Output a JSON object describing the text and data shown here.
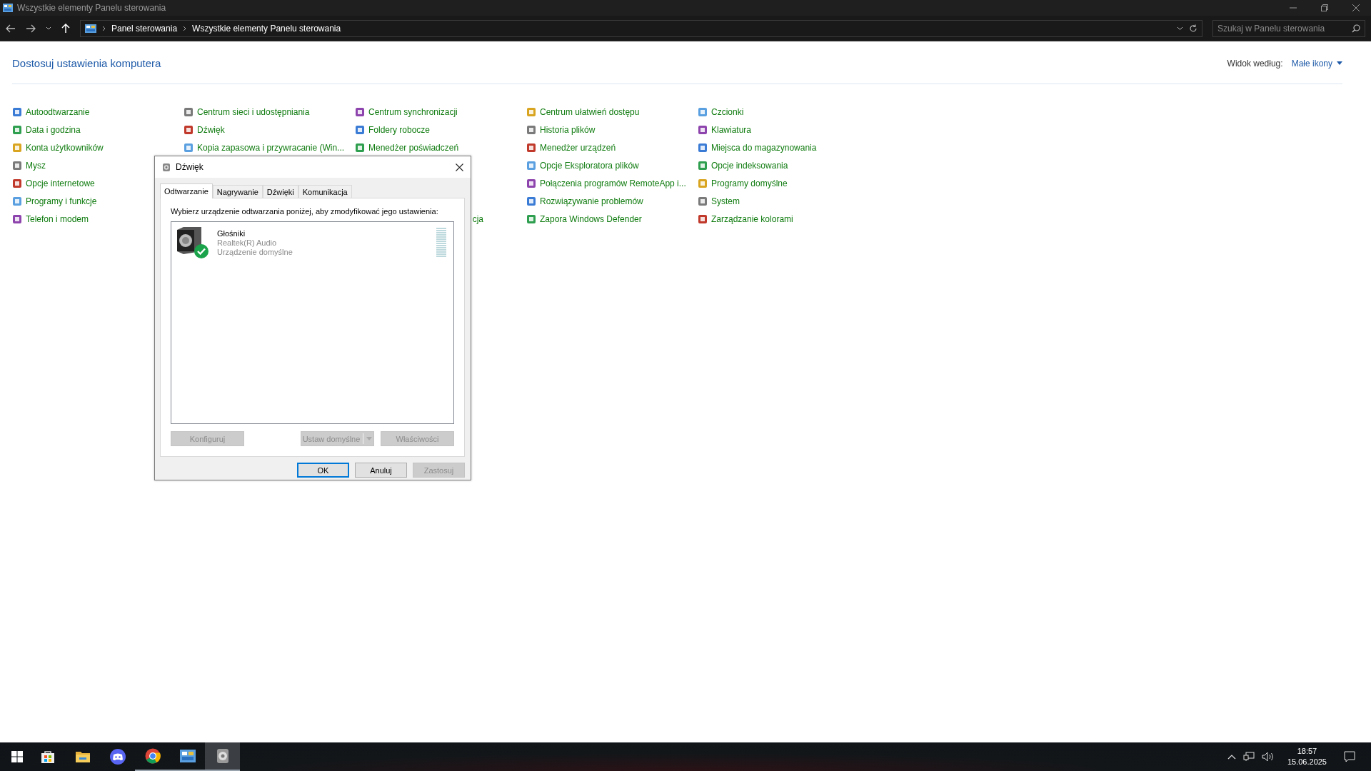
{
  "window": {
    "title": "Wszystkie elementy Panelu sterowania"
  },
  "address_bar": {
    "breadcrumbs": [
      "Panel sterowania",
      "Wszystkie elementy Panelu sterowania"
    ]
  },
  "search": {
    "placeholder": "Szukaj w Panelu sterowania"
  },
  "heading": "Dostosuj ustawienia komputera",
  "view_by": {
    "label": "Widok według:",
    "value": "Małe ikony"
  },
  "columns": [
    [
      {
        "label": "Autoodtwarzanie"
      },
      {
        "label": "Data i godzina"
      },
      {
        "label": "Konta użytkowników"
      },
      {
        "label": "Mysz"
      },
      {
        "label": "Opcje internetowe"
      },
      {
        "label": "Programy i funkcje"
      },
      {
        "label": "Telefon i modem"
      }
    ],
    [
      {
        "label": "Centrum sieci i udostępniania"
      },
      {
        "label": "Dźwięk"
      },
      {
        "label": "Kopia zapasowa i przywracanie (Win..."
      }
    ],
    [
      {
        "label": "Centrum synchronizacji"
      },
      {
        "label": "Foldery robocze"
      },
      {
        "label": "Menedżer poświadczeń"
      },
      {
        "label": "cja",
        "kind": "fragment"
      }
    ],
    [
      {
        "label": "Centrum ułatwień dostępu"
      },
      {
        "label": "Historia plików"
      },
      {
        "label": "Menedżer urządzeń"
      },
      {
        "label": "Opcje Eksploratora plików"
      },
      {
        "label": "Połączenia programów RemoteApp i..."
      },
      {
        "label": "Rozwiązywanie problemów"
      },
      {
        "label": "Zapora Windows Defender"
      }
    ],
    [
      {
        "label": "Czcionki"
      },
      {
        "label": "Klawiatura"
      },
      {
        "label": "Miejsca do magazynowania"
      },
      {
        "label": "Opcje indeksowania"
      },
      {
        "label": "Programy domyślne"
      },
      {
        "label": "System"
      },
      {
        "label": "Zarządzanie kolorami"
      }
    ]
  ],
  "dialog": {
    "title": "Dźwięk",
    "tabs": [
      {
        "label": "Odtwarzanie",
        "selected": true
      },
      {
        "label": "Nagrywanie",
        "selected": false
      },
      {
        "label": "Dźwięki",
        "selected": false
      },
      {
        "label": "Komunikacja",
        "selected": false
      }
    ],
    "instruction": "Wybierz urządzenie odtwarzania poniżej, aby zmodyfikować jego ustawienia:",
    "devices": [
      {
        "name": "Głośniki",
        "driver": "Realtek(R) Audio",
        "status": "Urządzenie domyślne",
        "default": true,
        "level": 0
      }
    ],
    "buttons": [
      {
        "label": "Konfiguruj",
        "disabled": true,
        "kind": "plain"
      },
      {
        "label": "Ustaw domyślne",
        "disabled": true,
        "kind": "split"
      },
      {
        "label": "Właściwości",
        "disabled": true,
        "kind": "plain"
      }
    ],
    "footer_buttons": [
      {
        "label": "OK",
        "disabled": false,
        "default": true
      },
      {
        "label": "Anuluj",
        "disabled": false,
        "default": false
      },
      {
        "label": "Zastosuj",
        "disabled": true,
        "default": false
      }
    ]
  },
  "taskbar": {
    "apps": [
      {
        "running": false,
        "active": false
      },
      {
        "running": false,
        "active": false
      },
      {
        "running": false,
        "active": false
      },
      {
        "running": true,
        "active": false
      },
      {
        "running": true,
        "active": false
      },
      {
        "running": true,
        "active": true
      }
    ],
    "time": "18:57",
    "date": "15.06.2025"
  }
}
